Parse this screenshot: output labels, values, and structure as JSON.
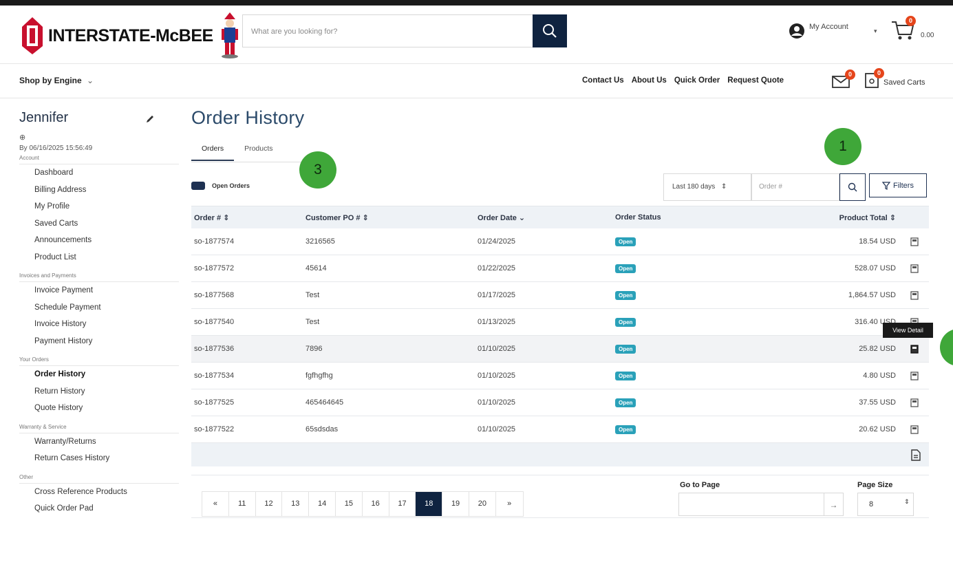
{
  "brand": {
    "name": "INTERSTATE-McBEE"
  },
  "search": {
    "placeholder": "What are you looking for?"
  },
  "account": {
    "label": "My Account"
  },
  "cart": {
    "count": "0",
    "total": "0.00"
  },
  "nav": {
    "shop_by_engine": "Shop by Engine",
    "links": [
      "Contact Us",
      "About Us",
      "Quick Order",
      "Request Quote"
    ],
    "mail_badge": "0",
    "saved_carts_badge": "0",
    "saved_carts": "Saved Carts"
  },
  "sidebar": {
    "user_name": "Jennifer",
    "user_date": "By 06/16/2025 15:56:49",
    "sections": [
      {
        "title": "Account",
        "items": [
          "Dashboard",
          "Billing Address",
          "My Profile",
          "Saved Carts",
          "Announcements",
          "Product List"
        ]
      },
      {
        "title": "Invoices and Payments",
        "items": [
          "Invoice Payment",
          "Schedule Payment",
          "Invoice History",
          "Payment History"
        ]
      },
      {
        "title": "Your Orders",
        "items": [
          "Order History",
          "Return History",
          "Quote History"
        ]
      },
      {
        "title": "Warranty & Service",
        "items": [
          "Warranty/Returns",
          "Return Cases History"
        ]
      },
      {
        "title": "Other",
        "items": [
          "Cross Reference Products",
          "Quick Order Pad"
        ]
      }
    ]
  },
  "main": {
    "title": "Order History",
    "tabs": [
      "Orders",
      "Products"
    ],
    "open_orders": "Open Orders",
    "date_range": "Last 180 days",
    "order_placeholder": "Order #",
    "filters": "Filters",
    "callouts": [
      "1",
      "3"
    ],
    "columns": [
      "Order # ⇕",
      "Customer PO # ⇕",
      "Order Date ⌄",
      "Order Status",
      "Product Total ⇕"
    ],
    "rows": [
      {
        "order": "so-1877574",
        "po": "3216565",
        "date": "01/24/2025",
        "status": "Open",
        "total": "18.54 USD"
      },
      {
        "order": "so-1877572",
        "po": "45614",
        "date": "01/22/2025",
        "status": "Open",
        "total": "528.07 USD"
      },
      {
        "order": "so-1877568",
        "po": "Test",
        "date": "01/17/2025",
        "status": "Open",
        "total": "1,864.57 USD"
      },
      {
        "order": "so-1877540",
        "po": "Test",
        "date": "01/13/2025",
        "status": "Open",
        "total": "316.40 USD"
      },
      {
        "order": "so-1877536",
        "po": "7896",
        "date": "01/10/2025",
        "status": "Open",
        "total": "25.82 USD"
      },
      {
        "order": "so-1877534",
        "po": "fgfhgfhg",
        "date": "01/10/2025",
        "status": "Open",
        "total": "4.80 USD"
      },
      {
        "order": "so-1877525",
        "po": "465464645",
        "date": "01/10/2025",
        "status": "Open",
        "total": "37.55 USD"
      },
      {
        "order": "so-1877522",
        "po": "65sdsdas",
        "date": "01/10/2025",
        "status": "Open",
        "total": "20.62 USD"
      }
    ],
    "tooltip": "View Detail"
  },
  "pagination": {
    "pages": [
      "«",
      "11",
      "12",
      "13",
      "14",
      "15",
      "16",
      "17",
      "18",
      "19",
      "20",
      "»"
    ],
    "active": "18",
    "goto_label": "Go to Page",
    "goto_button": "→",
    "size_label": "Page Size",
    "size_value": "8"
  },
  "colors": {
    "navy": "#0f2340",
    "title": "#2b4a6a",
    "status": "#2aa1b9",
    "callout": "#3fa739",
    "badge": "#e5451b"
  }
}
